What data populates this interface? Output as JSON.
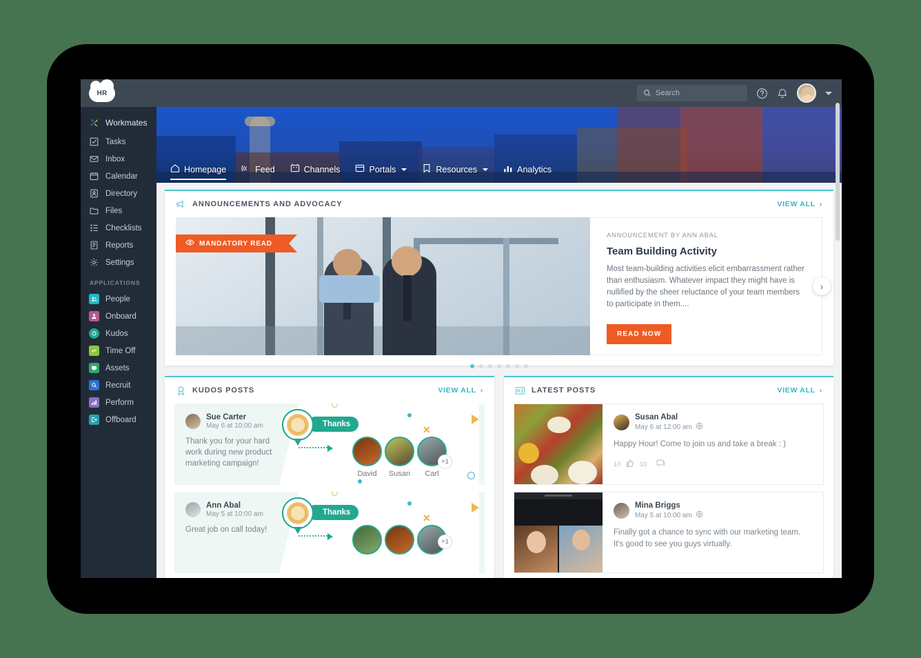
{
  "header": {
    "logo_text": "HR",
    "search": {
      "placeholder": "Search",
      "value": ""
    },
    "help_icon": "help-circle-icon",
    "bell_icon": "notification-bell-icon",
    "avatar_icon": "user-avatar",
    "chevron_icon": "chevron-down-icon"
  },
  "sidebar": {
    "primary": [
      {
        "label": "Workmates",
        "icon": "workmates-pinwheel-icon"
      },
      {
        "label": "Tasks",
        "icon": "task-checkbox-icon"
      },
      {
        "label": "Inbox",
        "icon": "inbox-tray-icon"
      },
      {
        "label": "Calendar",
        "icon": "calendar-icon"
      },
      {
        "label": "Directory",
        "icon": "directory-person-icon"
      },
      {
        "label": "Files",
        "icon": "folder-icon"
      },
      {
        "label": "Checklists",
        "icon": "checklist-icon"
      },
      {
        "label": "Reports",
        "icon": "report-document-icon"
      },
      {
        "label": "Settings",
        "icon": "gear-icon"
      }
    ],
    "apps_heading": "APPLICATIONS",
    "apps": [
      {
        "label": "People",
        "icon": "people-app-icon",
        "color": "#22b9c6"
      },
      {
        "label": "Onboard",
        "icon": "onboard-app-icon",
        "color": "#b7588f"
      },
      {
        "label": "Kudos",
        "icon": "kudos-app-icon",
        "color": "#1fa98e"
      },
      {
        "label": "Time Off",
        "icon": "timeoff-app-icon",
        "color": "#8cc63f"
      },
      {
        "label": "Assets",
        "icon": "assets-app-icon",
        "color": "#2aa86f"
      },
      {
        "label": "Recruit",
        "icon": "recruit-app-icon",
        "color": "#2b72d0"
      },
      {
        "label": "Perform",
        "icon": "perform-app-icon",
        "color": "#8a6fc4"
      },
      {
        "label": "Offboard",
        "icon": "offboard-app-icon",
        "color": "#2a9fae"
      }
    ]
  },
  "nav": {
    "tabs": [
      {
        "label": "Homepage",
        "icon": "home-icon",
        "active": true,
        "dropdown": false
      },
      {
        "label": "Feed",
        "icon": "rss-feed-icon",
        "active": false,
        "dropdown": false
      },
      {
        "label": "Channels",
        "icon": "channels-icon",
        "active": false,
        "dropdown": false
      },
      {
        "label": "Portals",
        "icon": "portals-icon",
        "active": false,
        "dropdown": true
      },
      {
        "label": "Resources",
        "icon": "bookmark-icon",
        "active": false,
        "dropdown": true
      },
      {
        "label": "Analytics",
        "icon": "analytics-bar-icon",
        "active": false,
        "dropdown": false
      }
    ]
  },
  "announcements": {
    "heading": "ANNOUNCEMENTS AND ADVOCACY",
    "heading_icon": "megaphone-icon",
    "view_all": "VIEW ALL",
    "badge": "MANDATORY READ",
    "badge_icon": "eye-icon",
    "byline": "ANNOUNCEMENT BY ANN ABAL",
    "title": "Team Building Activity",
    "description": "Most team-building activities elicit embarrassment rather than enthusiasm. Whatever impact they might have is nullified by the sheer reluctance of your team members to participate in them....",
    "cta": "READ NOW",
    "next_icon": "chevron-right-icon",
    "dots_total": 7,
    "dots_active": 1
  },
  "kudos": {
    "heading": "KUDOS POSTS",
    "heading_icon": "kudos-ribbon-icon",
    "view_all": "VIEW ALL",
    "posts": [
      {
        "author": "Sue Carter",
        "date": "May 6 at 10:00 am",
        "message": "Thank you for your hard work during new product marketing campaign!",
        "badge_label": "Thanks",
        "recipients": [
          {
            "name": "David"
          },
          {
            "name": "Susan"
          },
          {
            "name": "Carl"
          }
        ],
        "extra": "+1"
      },
      {
        "author": "Ann Abal",
        "date": "May 5 at 10:00 am",
        "message": "Great job on call today!",
        "badge_label": "Thanks",
        "recipients": [
          {
            "name": ""
          },
          {
            "name": ""
          },
          {
            "name": ""
          }
        ],
        "extra": "+1"
      }
    ]
  },
  "latest_posts": {
    "heading": "LATEST POSTS",
    "heading_icon": "posts-card-icon",
    "view_all": "VIEW ALL",
    "posts": [
      {
        "author": "Susan Abal",
        "date": "May 6 at 12:00 am",
        "visibility_icon": "globe-icon",
        "message": "Happy Hour! Come to join us and take a break : )",
        "reactions": {
          "likes": "10",
          "thumbs": "10",
          "thumb_icon": "thumbs-up-icon",
          "comment_icon": "comment-icon"
        }
      },
      {
        "author": "Mina Briggs",
        "date": "May 5 at 10:00 am",
        "visibility_icon": "globe-icon",
        "message": "Finally got a chance to sync with our marketing team. It's good to see you guys virtually.",
        "reactions": {
          "likes": "",
          "thumbs": "",
          "thumb_icon": "thumbs-up-icon",
          "comment_icon": "comment-icon"
        }
      }
    ]
  },
  "colors": {
    "page_background": "#477450",
    "sidebar": "#222c38",
    "topbar": "#3d4854",
    "accent_teal": "#4bc6d0",
    "accent_orange": "#ef5b25",
    "kudos_green": "#22a88e"
  }
}
